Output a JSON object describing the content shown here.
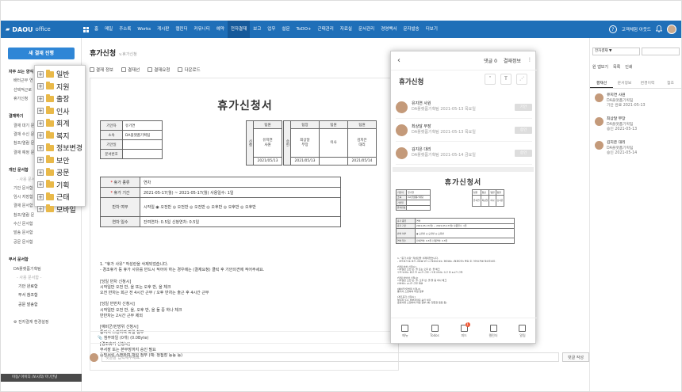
{
  "app": {
    "logo": "DAOU",
    "logo_sub": "office",
    "nav": [
      "홈",
      "메일",
      "주소록",
      "Works",
      "게시판",
      "캘린더",
      "커뮤니티",
      "예약",
      "전자결재",
      "보고",
      "업무",
      "설문",
      "ToDO+",
      "근태관리",
      "자료실",
      "문서관리",
      "경영백서",
      "문자발송",
      "더보기"
    ],
    "nav_active": "전자결재",
    "user_name": "고객체험 아웃드"
  },
  "sidebar": {
    "new_button": "새 결재 진행",
    "items": [
      {
        "label": "자주 쓰는 양식",
        "kind": "head"
      },
      {
        "label": "배터근무 연",
        "kind": "sub"
      },
      {
        "label": "선택적근로",
        "kind": "sub"
      },
      {
        "label": "휴가신청",
        "kind": "sub"
      },
      {
        "label": "",
        "kind": "sub"
      },
      {
        "label": "결재하기",
        "kind": "head"
      },
      {
        "label": "결재 대기 문",
        "kind": "sub"
      },
      {
        "label": "결재 수신 문",
        "kind": "sub"
      },
      {
        "label": "참조/열람 문",
        "kind": "sub"
      },
      {
        "label": "결재 예정 문",
        "kind": "sub"
      },
      {
        "label": "",
        "kind": "sub"
      },
      {
        "label": "개인 문서함",
        "kind": "head"
      },
      {
        "label": "- 사용 문서",
        "kind": "gray"
      },
      {
        "label": "기안 문서함",
        "kind": "sub"
      },
      {
        "label": "임시 저장함",
        "kind": "sub"
      },
      {
        "label": "결재 문서함",
        "kind": "sub"
      },
      {
        "label": "참조/열람 문",
        "kind": "sub"
      },
      {
        "label": "수신 문서함",
        "kind": "sub"
      },
      {
        "label": "발송 문서함",
        "kind": "sub"
      },
      {
        "label": "공문 문서함",
        "kind": "sub"
      },
      {
        "label": "",
        "kind": "sub"
      },
      {
        "label": "부서 문서함",
        "kind": "head"
      },
      {
        "label": "DA플랫폼기획팀",
        "kind": "sub"
      },
      {
        "label": "- 사용 문서함 -",
        "kind": "gray"
      },
      {
        "label": "기안 완료함",
        "kind": "center"
      },
      {
        "label": "부서 참조함",
        "kind": "center"
      },
      {
        "label": "공문 발송함",
        "kind": "center"
      },
      {
        "label": "",
        "kind": "sub"
      },
      {
        "label": "⚙ 전자결재 환경설정",
        "kind": "sub"
      }
    ],
    "status_bar": "이동/ 아이디 /보시작/ 마 /안녕"
  },
  "popup": {
    "items": [
      "일반",
      "지원",
      "출장",
      "인사",
      "회계",
      "복지",
      "정보변경",
      "보안",
      "공문",
      "기획",
      "근태",
      "모바일"
    ]
  },
  "main": {
    "title": "휴가신청",
    "version": "v.휴가신청",
    "toolbar": [
      "결재 정보",
      "결재선",
      "결재요청",
      "다운로드"
    ],
    "doc": {
      "title": "휴가신청서",
      "info": [
        {
          "label": "기안자",
          "value": "유기연"
        },
        {
          "label": "소속",
          "value": "DA플랫폼기획팀"
        },
        {
          "label": "기안일",
          "value": ""
        },
        {
          "label": "문서번호",
          "value": ""
        }
      ],
      "approval_left": {
        "side": "신청",
        "header": "팀원",
        "name": "유지연\n사원",
        "date": "2021/05/13"
      },
      "approval_right": {
        "side": "승인",
        "cols": [
          {
            "header": "팀장",
            "name": "최상달\n부장",
            "date": "2021/05/13"
          },
          {
            "header": "팀원",
            "name": "이사",
            "date": ""
          },
          {
            "header": "팀원",
            "name": "김지은\n대리",
            "date": "2021/05/14"
          }
        ]
      },
      "rows": [
        {
          "label": "휴가 종류",
          "req": true,
          "value": "연차"
        },
        {
          "label": "휴가 기간",
          "req": true,
          "value": "2021-05-17(월) ~ 2021-05-17(월)  사용일수: 1일"
        },
        {
          "label": "반차 여부",
          "req": false,
          "value": "시작일 ◉ 오전반 ◎ 오전반 ◎ 오전반 ◎ 오후반 ◎ 오후반 ◎ 오후반"
        },
        {
          "label": "연차 일수",
          "req": false,
          "value": "잔여연차: 0.5일   신청연차: 0.5일"
        }
      ],
      "notes": [
        "1. \"휴가 사유\" 작성란을 삭제되었습니다.",
        "- 경조휴가 등 휴가 사유를 반드시 적어야 하는 경우에는 (결재요청) 클릭 후 기안의견에 적어주세요.",
        "",
        "[당일 반차 신청시]",
        "시작일만 오전 반, 을 또는 오후 반, 을 체크",
        "오전 반차는 회근 전 4시간 근무 / 오후 반차는 출근 후 4시간 근무",
        "",
        "[당일 반반차 신청시]",
        "시작일만 오전 반, 을, 오후 반, 을 둘 중 하나 체크",
        "반반차는 2시간 근무 제외",
        "",
        "[예비군/민방위 신청시]",
        "통지서 스캔하여 파일 첨부",
        "",
        "[경조휴가 신청시]",
        "부서장 또는 본부장까지 승인 필요",
        "증빙서류 스캔하여 파일 첨부 (예: 청첩장 등등 등)"
      ]
    },
    "attach_label": "첨부파일 (0개) (0.0Byte)",
    "comment_placeholder": "댓글을 입력해주세요.",
    "comment_button": "댓글 작성"
  },
  "rpanel": {
    "search_select": "전자결재 ▼",
    "tools": [
      "원 앱보기",
      "목록",
      "인쇄"
    ],
    "tabs": [
      "결재선",
      "문서정보",
      "변경이력",
      "참조"
    ],
    "active_tab": "결재선",
    "people": [
      {
        "name": "유지연 사원",
        "team": "DA플랫폼기획팀",
        "date": "기안 완료 2021-05-13"
      },
      {
        "name": "최상달 부장",
        "team": "DA플랫폼기획팀",
        "date": "승인 2021-05-13"
      },
      {
        "name": "김지은 대리",
        "team": "DA플랫폼기획팀",
        "date": "승인 2021-05-14"
      }
    ]
  },
  "phone": {
    "top_right": [
      "댓글 0",
      "결재정보",
      "⋮"
    ],
    "title": "휴가신청",
    "people": [
      {
        "name": "유지연 사원",
        "sub": "DA플랫폼기획팀  2021-05-13 목요일",
        "btn": "기안"
      },
      {
        "name": "최상달 부장",
        "sub": "DA플랫폼기획팀  2021-05-13 목요일",
        "btn": "승인"
      },
      {
        "name": "김지은 대리",
        "sub": "DA플랫폼기획팀  2021-05-14 금요일",
        "btn": "승인"
      }
    ],
    "doc_title": "휴가신청서",
    "bottom_nav": [
      "메뉴",
      "Todos",
      "피드",
      "캘린더",
      "알림"
    ],
    "badge": "1"
  }
}
